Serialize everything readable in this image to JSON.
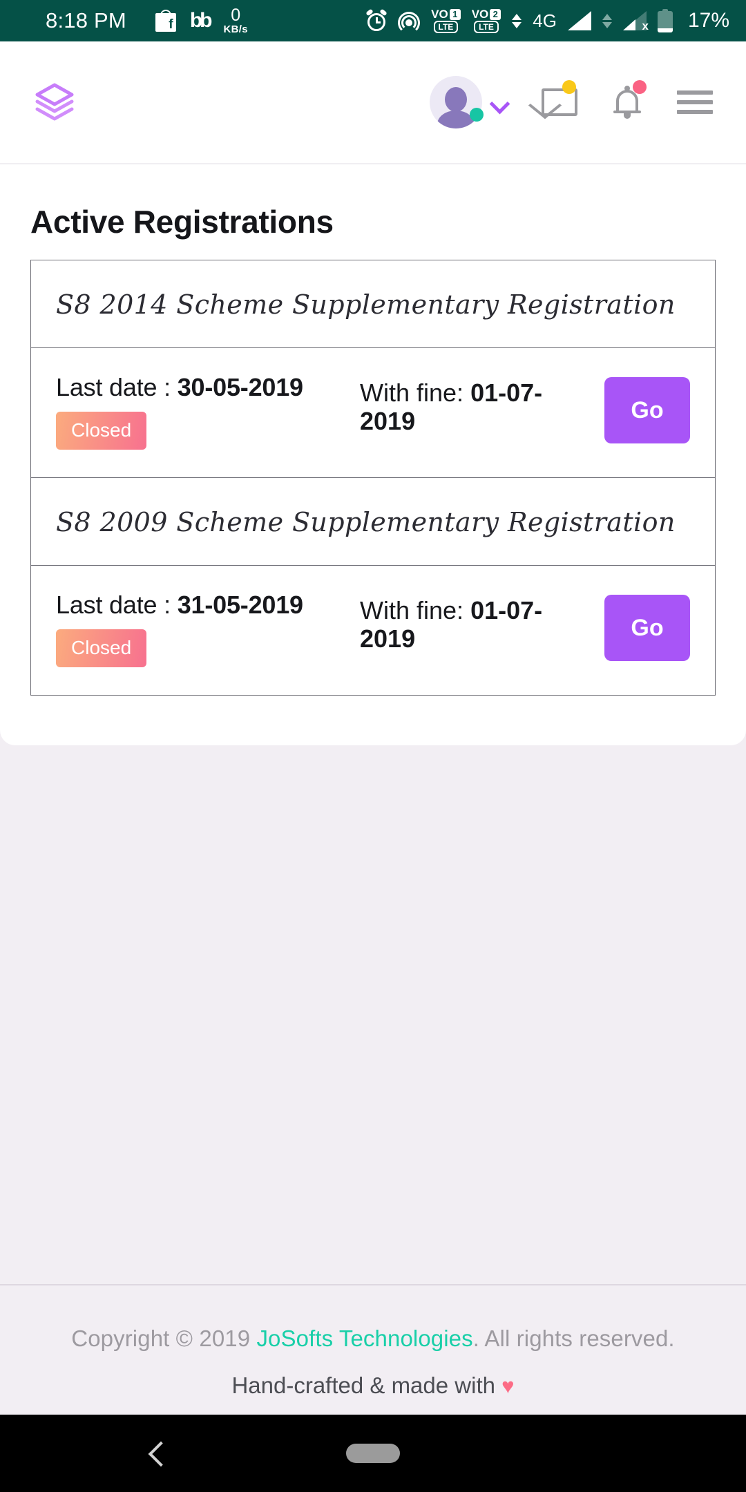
{
  "statusbar": {
    "time": "8:18 PM",
    "bb_label": "bb",
    "net_speed_value": "0",
    "net_speed_unit": "KB/s",
    "volte1_label": "VO",
    "volte1_sim": "1",
    "volte1_lte": "LTE",
    "volte2_label": "VO",
    "volte2_sim": "2",
    "volte2_lte": "LTE",
    "network_type": "4G",
    "sim2_no_service": "x",
    "battery": "17%",
    "background_color": "#055147",
    "icons": [
      "facebook-marketplace-icon",
      "bb-icon",
      "network-speed-icon",
      "alarm-icon",
      "hotspot-icon",
      "volte-sim1-icon",
      "volte-sim2-icon",
      "signal-sim1-icon",
      "signal-sim2-icon",
      "battery-icon"
    ]
  },
  "header": {
    "logo_icon": "layers-stack-logo",
    "logo_color": "#c77dfa",
    "avatar_icon": "user-avatar",
    "avatar_status": "online",
    "avatar_status_color": "#17c5a4",
    "chevron_icon": "chevron-down-icon",
    "mail_icon": "envelope-icon",
    "mail_badge_color": "#f9c819",
    "bell_icon": "bell-icon",
    "bell_badge_color": "#fa6283",
    "menu_icon": "hamburger-menu-icon"
  },
  "main": {
    "title": "Active Registrations",
    "registrations": [
      {
        "scheme": "S8 2014 Scheme Supplementary Registration",
        "last_date_label": "Last date : ",
        "last_date": "30-05-2019",
        "status": "Closed",
        "fine_label": "With fine: ",
        "fine_date": "01-07-2019",
        "action": "Go"
      },
      {
        "scheme": "S8 2009 Scheme Supplementary Registration",
        "last_date_label": "Last date : ",
        "last_date": "31-05-2019",
        "status": "Closed",
        "fine_label": "With fine: ",
        "fine_date": "01-07-2019",
        "action": "Go"
      }
    ]
  },
  "footer": {
    "copyright_prefix": "Copyright © 2019 ",
    "brand": "JoSofts Technologies",
    "copyright_suffix": ". All rights reserved.",
    "tagline": "Hand-crafted & made with ",
    "heart": "♥",
    "brand_color": "#19cfa8",
    "heart_color": "#fc6b85"
  },
  "navbar": {
    "back_icon": "back-chevron-icon",
    "home_icon": "home-pill-icon"
  }
}
